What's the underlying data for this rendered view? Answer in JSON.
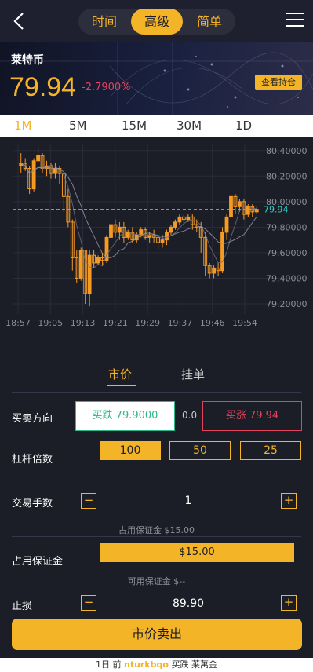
{
  "nav": {
    "tabs": [
      "时间",
      "高级",
      "简单"
    ],
    "active_tab": "高级"
  },
  "hero": {
    "name": "莱特币",
    "price": "79.94",
    "change": "-2.7900%",
    "holdings_button": "查看持仓"
  },
  "periods": [
    "1M",
    "5M",
    "15M",
    "30M",
    "1D"
  ],
  "active_period": "1M",
  "chart_data": {
    "type": "candlestick",
    "y_ticks": [
      "80.40000",
      "80.20000",
      "80.00000",
      "79.80000",
      "79.60000",
      "79.40000",
      "79.20000"
    ],
    "x_ticks": [
      "18:57",
      "19:05",
      "19:13",
      "19:21",
      "19:29",
      "19:37",
      "19:46",
      "19:54"
    ],
    "ylim": [
      79.12,
      80.46
    ],
    "current_price_label": "79.94",
    "current_price": 79.94,
    "candles": [
      [
        80.28,
        80.38,
        80.3,
        80.22
      ],
      [
        80.3,
        80.34,
        80.26,
        80.24
      ],
      [
        80.26,
        80.28,
        80.1,
        80.06
      ],
      [
        80.1,
        80.34,
        80.32,
        80.08
      ],
      [
        80.32,
        80.42,
        80.36,
        80.3
      ],
      [
        80.36,
        80.38,
        80.26,
        80.22
      ],
      [
        80.26,
        80.32,
        80.28,
        80.2
      ],
      [
        80.28,
        80.3,
        80.22,
        80.18
      ],
      [
        80.22,
        80.3,
        80.26,
        80.18
      ],
      [
        80.26,
        80.28,
        80.22,
        80.14
      ],
      [
        80.22,
        80.06,
        80.04,
        79.92
      ],
      [
        80.04,
        80.1,
        79.84,
        79.8
      ],
      [
        79.84,
        79.86,
        79.56,
        79.46
      ],
      [
        79.56,
        79.62,
        79.4,
        79.36
      ],
      [
        79.4,
        79.64,
        79.62,
        79.38
      ],
      [
        79.62,
        79.62,
        79.28,
        79.2
      ],
      [
        79.28,
        79.62,
        79.58,
        79.18
      ],
      [
        79.58,
        79.62,
        79.52,
        79.48
      ],
      [
        79.52,
        79.58,
        79.56,
        79.5
      ],
      [
        79.56,
        79.6,
        79.54,
        79.5
      ],
      [
        79.54,
        79.74,
        79.72,
        79.52
      ],
      [
        79.72,
        79.84,
        79.82,
        79.7
      ],
      [
        79.82,
        79.86,
        79.76,
        79.72
      ],
      [
        79.76,
        79.84,
        79.8,
        79.7
      ],
      [
        79.8,
        79.84,
        79.72,
        79.68
      ],
      [
        79.72,
        79.78,
        79.76,
        79.7
      ],
      [
        79.76,
        79.8,
        79.7,
        79.68
      ],
      [
        79.7,
        79.76,
        79.74,
        79.68
      ],
      [
        79.74,
        79.8,
        79.78,
        79.72
      ],
      [
        79.78,
        79.8,
        79.72,
        79.7
      ],
      [
        79.72,
        79.76,
        79.74,
        79.68
      ],
      [
        79.74,
        79.78,
        79.72,
        79.68
      ],
      [
        79.72,
        79.74,
        79.68,
        79.62
      ],
      [
        79.68,
        79.74,
        79.7,
        79.64
      ],
      [
        79.7,
        79.78,
        79.76,
        79.66
      ],
      [
        79.76,
        79.82,
        79.8,
        79.74
      ],
      [
        79.8,
        79.86,
        79.84,
        79.78
      ],
      [
        79.84,
        79.9,
        79.88,
        79.82
      ],
      [
        79.88,
        79.9,
        79.86,
        79.82
      ],
      [
        79.86,
        79.9,
        79.88,
        79.84
      ],
      [
        79.88,
        79.9,
        79.82,
        79.78
      ],
      [
        79.82,
        79.86,
        79.8,
        79.76
      ],
      [
        79.8,
        79.84,
        79.72,
        79.6
      ],
      [
        79.72,
        79.76,
        79.5,
        79.42
      ],
      [
        79.5,
        79.52,
        79.44,
        79.4
      ],
      [
        79.44,
        79.5,
        79.48,
        79.4
      ],
      [
        79.48,
        79.52,
        79.46,
        79.42
      ],
      [
        79.46,
        79.8,
        79.76,
        79.44
      ],
      [
        79.76,
        79.9,
        79.88,
        79.7
      ],
      [
        79.88,
        80.06,
        80.04,
        79.86
      ],
      [
        80.04,
        80.06,
        79.96,
        79.9
      ],
      [
        79.96,
        80.02,
        80.0,
        79.92
      ],
      [
        80.0,
        80.02,
        79.9,
        79.86
      ],
      [
        79.9,
        79.98,
        79.96,
        79.88
      ],
      [
        79.96,
        79.98,
        79.92,
        79.88
      ],
      [
        79.92,
        79.96,
        79.94,
        79.9
      ]
    ]
  },
  "order": {
    "tabs": [
      "市价",
      "挂单"
    ],
    "active_tab": "市价",
    "direction_label": "买卖方向",
    "buy_fall": "买跌 79.9000",
    "spread": "0.0",
    "buy_rise": "买涨 79.94",
    "leverage_label": "杠杆倍数",
    "leverage_options": [
      "100",
      "50",
      "25"
    ],
    "active_leverage": "100",
    "lots_label": "交易手数",
    "lots_value": "1",
    "margin_note": "占用保证金 $15.00",
    "margin_label": "占用保证金",
    "margin_value": "$15.00",
    "available_note": "可用保证金 $--",
    "stoploss_label": "止损",
    "stoploss_value": "89.90",
    "minus": "−",
    "plus": "+",
    "submit": "市价卖出"
  },
  "ticker": {
    "prefix": "1日 前",
    "user": "nturkbqo",
    "action": "买跌 莱萬金"
  },
  "colors": {
    "accent": "#f4b428",
    "up": "#e7425c",
    "down": "#2ab78b",
    "candle": "#f59a23",
    "price_line": "#2bd6c8"
  }
}
